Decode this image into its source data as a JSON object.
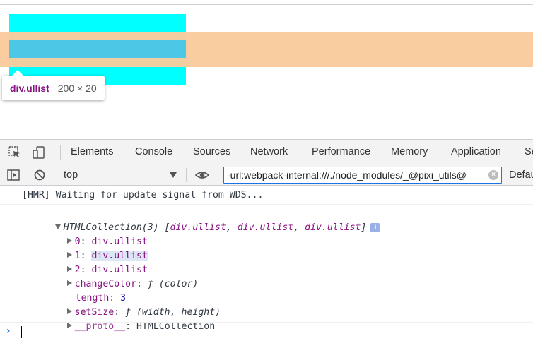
{
  "tooltip": {
    "element": "div.ullist",
    "size": "200 × 20"
  },
  "devtools": {
    "tabs": [
      "Elements",
      "Console",
      "Sources",
      "Network",
      "Performance",
      "Memory",
      "Application",
      "Se"
    ],
    "active_tab": "Console",
    "toolbar": {
      "context": "top",
      "filter_value": "-url:webpack-internal:///./node_modules/_@pixi_utils@",
      "levels": "Defau"
    }
  },
  "console": {
    "hmr": "[HMR] Waiting for update signal from WDS...",
    "collection": {
      "head": "HTMLCollection(3) [",
      "items_inline": [
        "div.ullist",
        "div.ullist",
        "div.ullist"
      ],
      "close": "]",
      "info": "i",
      "entries": [
        {
          "key": "0",
          "value": "div.ullist"
        },
        {
          "key": "1",
          "value": "div.ullist"
        },
        {
          "key": "2",
          "value": "div.ullist"
        },
        {
          "key": "changeColor",
          "value": "ƒ (color)"
        },
        {
          "key": "length",
          "value": "3"
        },
        {
          "key": "setSize",
          "value": "ƒ (width, height)"
        },
        {
          "key": "__proto__",
          "value": "HTMLCollection"
        }
      ]
    },
    "prompt": "›"
  },
  "colors": {
    "accent": "#1a73e8",
    "cyan": "#00ffff",
    "highlight": "#4cc7e6",
    "margin": "#f9cb9c"
  }
}
